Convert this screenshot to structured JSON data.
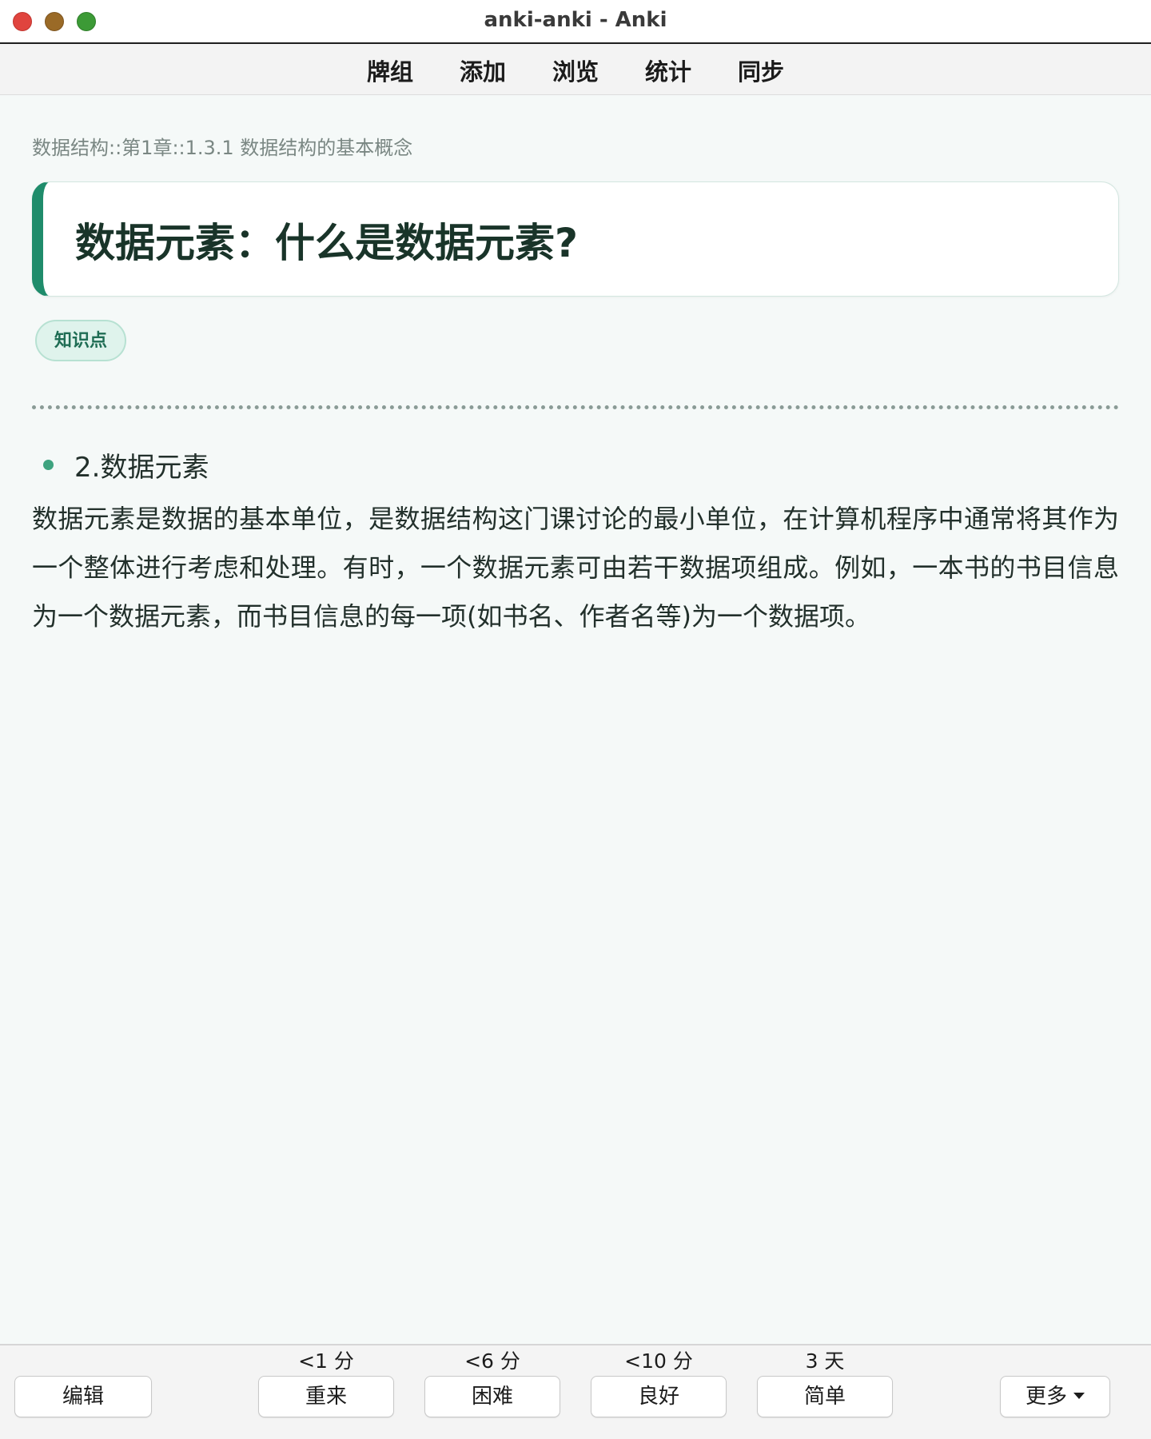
{
  "window": {
    "title": "anki-anki - Anki"
  },
  "toolbar": {
    "items": [
      "牌组",
      "添加",
      "浏览",
      "统计",
      "同步"
    ]
  },
  "card": {
    "breadcrumb": "数据结构::第1章::1.3.1 数据结构的基本概念",
    "question": "数据元素：什么是数据元素?",
    "tag": "知识点",
    "bullet": "2.数据元素",
    "answer": "数据元素是数据的基本单位，是数据结构这门课讨论的最小单位，在计算机程序中通常将其作为一个整体进行考虑和处理。有时，一个数据元素可由若干数据项组成。例如，一本书的书目信息为一个数据元素，而书目信息的每一项(如书名、作者名等)为一个数据项。"
  },
  "bottombar": {
    "edit_label": "编辑",
    "more_label": "更多",
    "answers": [
      {
        "label": "重来",
        "interval": "<1 分"
      },
      {
        "label": "困难",
        "interval": "<6 分"
      },
      {
        "label": "良好",
        "interval": "<10 分"
      },
      {
        "label": "简单",
        "interval": "3 天"
      }
    ]
  },
  "colors": {
    "accent": "#1f8c6b",
    "tag_bg": "#dff3ec",
    "bullet": "#3ea37f",
    "close": "#e0443e",
    "minimize": "#9a6a27",
    "maximize": "#3c9a36"
  },
  "icons": {
    "more_caret": "caret-down-icon"
  }
}
